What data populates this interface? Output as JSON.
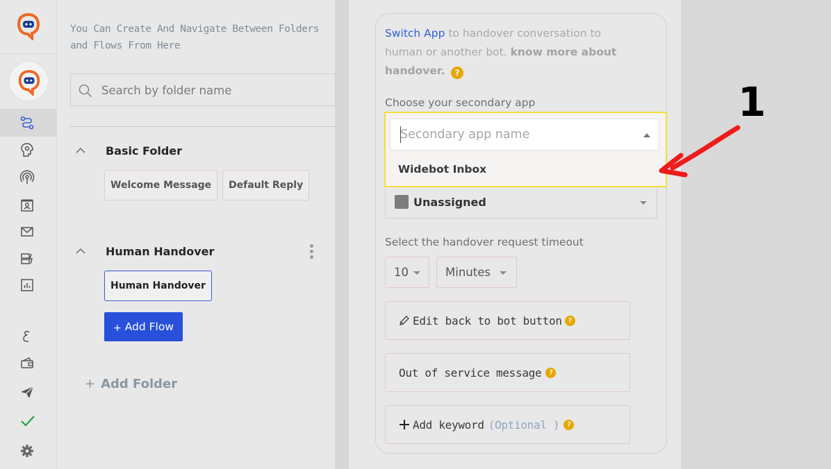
{
  "colors": {
    "brand_orange": "#f26522",
    "primary_blue": "#2850db",
    "link_blue": "#2f5fd8",
    "help_yellow": "#e5a800",
    "highlight_yellow": "#f3de3b",
    "annotation_red": "#ee1c1c"
  },
  "rail": {
    "icons": [
      "brand-logo-icon",
      "bot-avatar-icon",
      "flow-icon",
      "ai-brain-icon",
      "broadcast-icon",
      "contact-card-icon",
      "mail-icon",
      "template-icon",
      "analytics-icon",
      "language-icon",
      "wallet-icon",
      "send-icon",
      "check-icon",
      "settings-icon"
    ]
  },
  "folders": {
    "description": "You Can Create And Navigate Between Folders and Flows From Here",
    "search_placeholder": "Search by folder name",
    "groups": [
      {
        "title": "Basic Folder",
        "flows": [
          "Welcome Message",
          "Default Reply"
        ]
      },
      {
        "title": "Human Handover",
        "flows": [
          "Human Handover"
        ]
      }
    ],
    "add_flow_label": "Add Flow",
    "add_folder_label": "Add Folder"
  },
  "handover": {
    "intro_link": "Switch App",
    "intro_text": " to handover conversation to human or another bot. ",
    "intro_bold": "know more about handover.",
    "help_glyph": "?",
    "choose_label": "Choose your secondary app",
    "secondary_placeholder": "Secondary app name",
    "secondary_options": [
      "Widebot Inbox"
    ],
    "status_value": "Unassigned",
    "timeout_label": "Select the handover request timeout",
    "timeout_value": "10",
    "timeout_unit": "Minutes",
    "edit_back_label": "Edit back to bot button",
    "out_of_service_label": "Out of service message",
    "add_keyword_label": "Add keyword",
    "optional_label": "(Optional )"
  },
  "annotation": {
    "step_number": "1"
  }
}
